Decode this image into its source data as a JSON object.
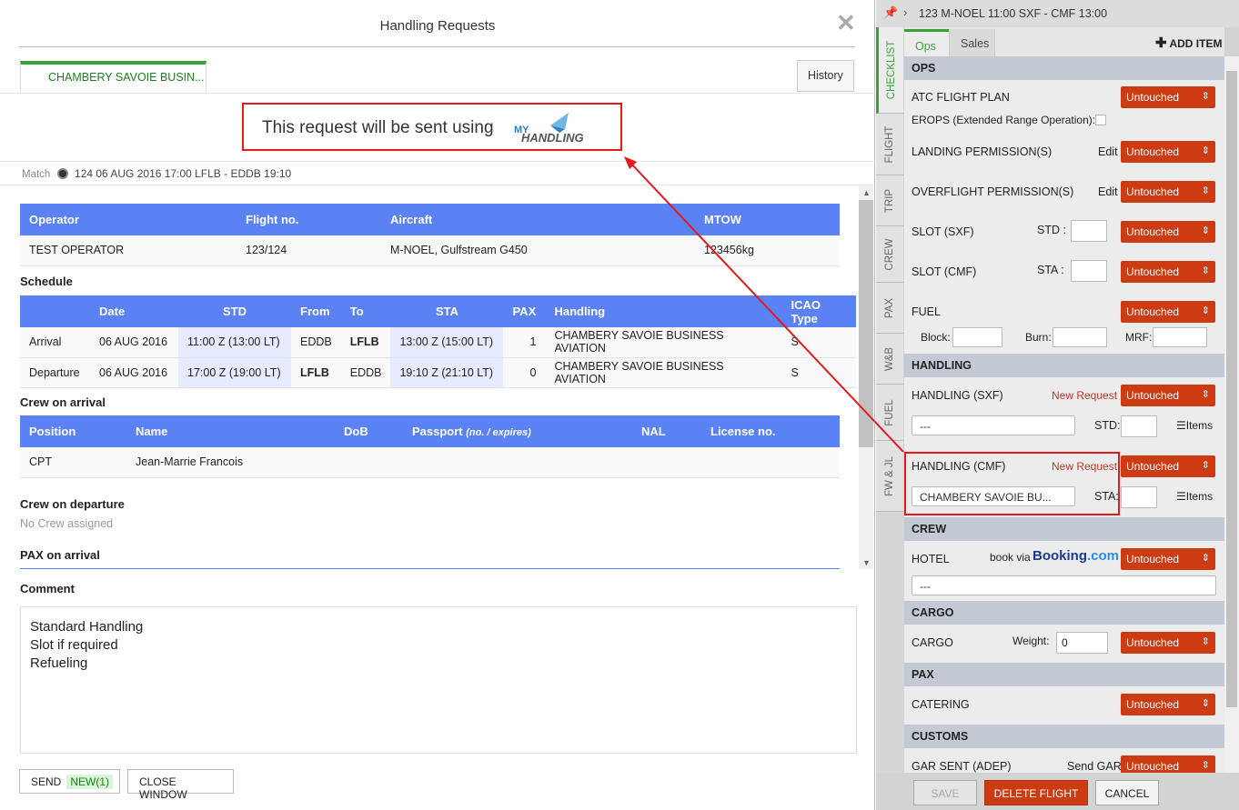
{
  "modal": {
    "title": "Handling Requests",
    "close": "✕",
    "tab": "CHAMBERY SAVOIE BUSIN...",
    "history": "History",
    "send_text": "This request will be sent using",
    "logo": "MY HANDLING",
    "match_label": "Match",
    "match_value": "124 06 AUG 2016 17:00 LFLB - EDDB 19:10"
  },
  "operator_table": {
    "headers": [
      "Operator",
      "Flight no.",
      "Aircraft",
      "MTOW"
    ],
    "row": [
      "TEST OPERATOR",
      "123/124",
      "M-NOEL, Gulfstream G450",
      "123456kg"
    ]
  },
  "schedule": {
    "title": "Schedule",
    "headers": [
      "",
      "Date",
      "STD",
      "From",
      "To",
      "STA",
      "PAX",
      "Handling",
      "ICAO Type"
    ],
    "rows": [
      [
        "Arrival",
        "06 AUG 2016",
        "11:00 Z (13:00 LT)",
        "EDDB",
        "LFLB",
        "13:00 Z (15:00 LT)",
        "1",
        "CHAMBERY SAVOIE BUSINESS AVIATION",
        "S"
      ],
      [
        "Departure",
        "06 AUG 2016",
        "17:00 Z (19:00 LT)",
        "LFLB",
        "EDDB",
        "19:10 Z (21:10 LT)",
        "0",
        "CHAMBERY SAVOIE BUSINESS AVIATION",
        "S"
      ]
    ]
  },
  "crew_arrival": {
    "title": "Crew on arrival",
    "headers": [
      "Position",
      "Name",
      "DoB",
      "Passport",
      "(no. / expires)",
      "NAL",
      "License no."
    ],
    "row": [
      "CPT",
      "Jean-Marrie Francois",
      "",
      "",
      "",
      "",
      ""
    ]
  },
  "crew_departure": {
    "title": "Crew on departure",
    "empty": "No Crew assigned"
  },
  "pax_arrival": {
    "title": "PAX on arrival"
  },
  "comment": {
    "label": "Comment",
    "text": "Standard Handling\nSlot if required\nRefueling"
  },
  "buttons": {
    "send": "SEND",
    "send_badge": "NEW(1)",
    "close": "CLOSE WINDOW"
  },
  "right": {
    "header": "123 M-NOEL 11:00 SXF - CMF 13:00",
    "side_tabs": [
      "CHECKLIST",
      "FLIGHT",
      "TRIP",
      "CREW",
      "PAX",
      "W&B",
      "FUEL",
      "FW & JL"
    ],
    "top_tabs": [
      "Ops",
      "Sales"
    ],
    "add_item": "ADD ITEM",
    "status": "Untouched",
    "edit": "Edit",
    "new_request": "New Request",
    "items": "Items",
    "none": "---",
    "ops": {
      "title": "OPS",
      "atc": "ATC FLIGHT PLAN",
      "erops": "EROPS (Extended Range Operation):",
      "landing": "LANDING PERMISSION(S)",
      "overflight": "OVERFLIGHT PERMISSION(S)",
      "slot_sxf": "SLOT (SXF)",
      "std": "STD :",
      "slot_cmf": "SLOT (CMF)",
      "sta": "STA :",
      "fuel": "FUEL",
      "block": "Block:",
      "burn": "Burn:",
      "mrf": "MRF:"
    },
    "handling": {
      "title": "HANDLING",
      "sxf": "HANDLING (SXF)",
      "cmf": "HANDLING (CMF)",
      "std": "STD:",
      "sta": "STA:",
      "cmf_value": "CHAMBERY SAVOIE BU..."
    },
    "crew": {
      "title": "CREW",
      "hotel": "HOTEL",
      "book_via": "book via",
      "booking": "Booking",
      "booking_dom": ".com"
    },
    "cargo": {
      "title": "CARGO",
      "cargo": "CARGO",
      "weight": "Weight:",
      "weight_value": "0"
    },
    "pax": {
      "title": "PAX",
      "catering": "CATERING"
    },
    "customs": {
      "title": "CUSTOMS",
      "gar": "GAR SENT (ADEP)",
      "send_gar": "Send GAR"
    },
    "footer": {
      "save": "SAVE",
      "delete": "DELETE FLIGHT",
      "cancel": "CANCEL"
    }
  },
  "colors": {
    "accent": "#5b82f5",
    "status": "#cd3b13",
    "highlight": "#e3191c",
    "tab_green": "#3aa13a"
  }
}
